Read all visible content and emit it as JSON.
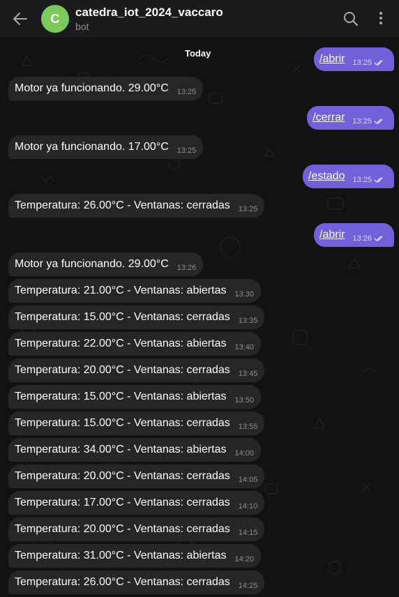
{
  "header": {
    "back_icon": "arrow-left-icon",
    "avatar_letter": "C",
    "avatar_color": "#7bc95a",
    "title": "catedra_iot_2024_vaccaro",
    "subtitle": "bot",
    "search_icon": "search-icon",
    "menu_icon": "more-vertical-icon"
  },
  "chat": {
    "date_label": "Today",
    "bubble_in_color": "#262628",
    "bubble_out_color": "#7161d8",
    "messages": [
      {
        "dir": "out",
        "text": "/abrir",
        "time": "13:25",
        "read": true
      },
      {
        "dir": "in",
        "text": "Motor ya funcionando. 29.00°C",
        "time": "13:25"
      },
      {
        "dir": "out",
        "text": "/cerrar",
        "time": "13:25",
        "read": true
      },
      {
        "dir": "in",
        "text": "Motor ya funcionando. 17.00°C",
        "time": "13:25"
      },
      {
        "dir": "out",
        "text": "/estado",
        "time": "13:25",
        "read": true
      },
      {
        "dir": "in",
        "text": "Temperatura: 26.00°C - Ventanas: cerradas",
        "time": "13:25"
      },
      {
        "dir": "out",
        "text": "/abrir",
        "time": "13:26",
        "read": true
      },
      {
        "dir": "in",
        "text": "Motor ya funcionando. 29.00°C",
        "time": "13:26"
      },
      {
        "dir": "in",
        "text": "Temperatura: 21.00°C - Ventanas: abiertas",
        "time": "13:30"
      },
      {
        "dir": "in",
        "text": "Temperatura: 15.00°C - Ventanas: cerradas",
        "time": "13:35"
      },
      {
        "dir": "in",
        "text": "Temperatura: 22.00°C - Ventanas: abiertas",
        "time": "13:40"
      },
      {
        "dir": "in",
        "text": "Temperatura: 20.00°C - Ventanas: cerradas",
        "time": "13:45"
      },
      {
        "dir": "in",
        "text": "Temperatura: 15.00°C - Ventanas: abiertas",
        "time": "13:50"
      },
      {
        "dir": "in",
        "text": "Temperatura: 15.00°C - Ventanas: cerradas",
        "time": "13:55"
      },
      {
        "dir": "in",
        "text": "Temperatura: 34.00°C - Ventanas: abiertas",
        "time": "14:00"
      },
      {
        "dir": "in",
        "text": "Temperatura: 20.00°C - Ventanas: cerradas",
        "time": "14:05"
      },
      {
        "dir": "in",
        "text": "Temperatura: 17.00°C - Ventanas: cerradas",
        "time": "14:10"
      },
      {
        "dir": "in",
        "text": "Temperatura: 20.00°C - Ventanas: cerradas",
        "time": "14:15"
      },
      {
        "dir": "in",
        "text": "Temperatura: 31.00°C - Ventanas: abiertas",
        "time": "14:20"
      },
      {
        "dir": "in",
        "text": "Temperatura: 26.00°C - Ventanas: cerradas",
        "time": "14:25"
      }
    ]
  }
}
